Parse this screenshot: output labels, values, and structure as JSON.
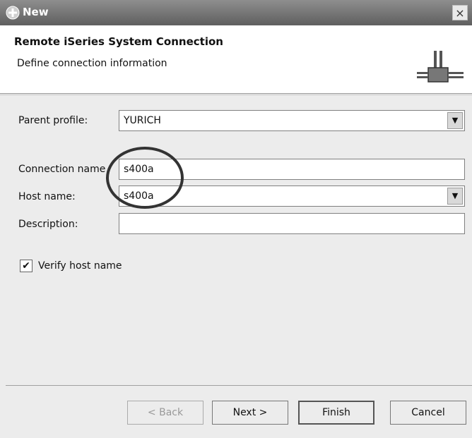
{
  "window": {
    "title": "New",
    "close_glyph": "×"
  },
  "header": {
    "title": "Remote iSeries System Connection",
    "description": "Define connection information",
    "icon": "connection-plug-icon"
  },
  "form": {
    "parent_profile_label": "Parent profile:",
    "parent_profile_value": "YURICH",
    "connection_name_label": "Connection name",
    "connection_name_value": "s400a",
    "host_name_label": "Host name:",
    "host_name_value": "s400a",
    "description_label": "Description:",
    "description_value": "",
    "verify_host_label": "Verify host name",
    "verify_host_checked": true,
    "verify_check_glyph": "✔",
    "combo_arrow_glyph": "▼"
  },
  "buttons": {
    "back": "< Back",
    "next": "Next >",
    "finish": "Finish",
    "cancel": "Cancel"
  }
}
